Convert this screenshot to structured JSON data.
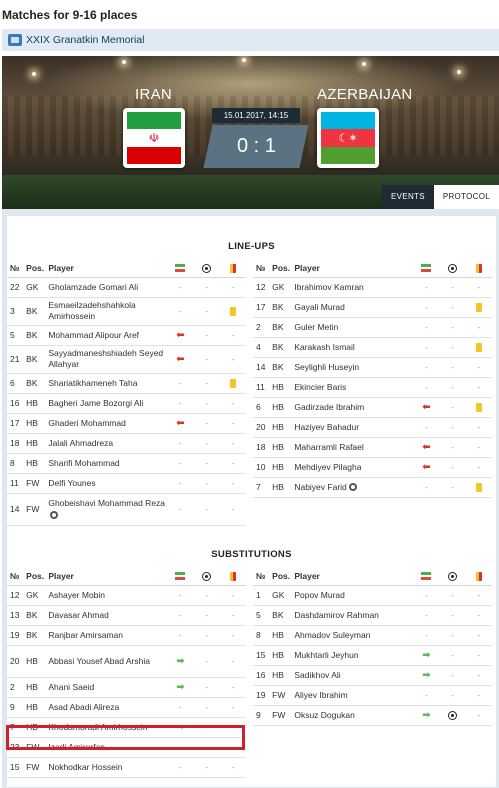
{
  "page_title": "Matches for 9-16 places",
  "tournament": {
    "name": "XXIX Granatkin Memorial",
    "icon": "trophy-icon"
  },
  "match": {
    "home_team": "IRAN",
    "away_team": "AZERBAIJAN",
    "datetime": "15.01.2017, 14:15",
    "score": "0 : 1"
  },
  "tabs": {
    "events": "EVENTS",
    "protocol": "PROTOCOL"
  },
  "colors": {
    "sub_in": "#5cb85c",
    "sub_out": "#d9342b",
    "yellow_card": "#f3c623",
    "highlight": "#d0202e"
  },
  "headers": {
    "no": "№",
    "pos": "Pos.",
    "player": "Player"
  },
  "lineups_title": "LINE-UPS",
  "subs_title": "SUBSTITUTIONS",
  "lineups_home": [
    {
      "no": "22",
      "pos": "GK",
      "name": "Gholamzade Gomari Ali",
      "sub": "-",
      "goal": "-",
      "card": "-"
    },
    {
      "no": "3",
      "pos": "BK",
      "name": "Esmaeilzadehshahkola Amirhossein",
      "sub": "-",
      "goal": "-",
      "card": "yellow"
    },
    {
      "no": "5",
      "pos": "BK",
      "name": "Mohammad Alipour Aref",
      "sub": "out",
      "goal": "-",
      "card": "-"
    },
    {
      "no": "21",
      "pos": "BK",
      "name": "Sayyadmaneshshiadeh Seyed Allahyar",
      "sub": "out",
      "goal": "-",
      "card": "-"
    },
    {
      "no": "6",
      "pos": "BK",
      "name": "Shariatikhameneh Taha",
      "sub": "-",
      "goal": "-",
      "card": "yellow"
    },
    {
      "no": "16",
      "pos": "HB",
      "name": "Bagheri Jame Bozorgi Ali",
      "sub": "-",
      "goal": "-",
      "card": "-"
    },
    {
      "no": "17",
      "pos": "HB",
      "name": "Ghaderi Mohammad",
      "sub": "out",
      "goal": "-",
      "card": "-"
    },
    {
      "no": "18",
      "pos": "HB",
      "name": "Jalali Ahmadreza",
      "sub": "-",
      "goal": "-",
      "card": "-"
    },
    {
      "no": "8",
      "pos": "HB",
      "name": "Sharifi Mohammad",
      "sub": "-",
      "goal": "-",
      "card": "-"
    },
    {
      "no": "11",
      "pos": "FW",
      "name": "Delfi Younes",
      "sub": "-",
      "goal": "-",
      "card": "-"
    },
    {
      "no": "14",
      "pos": "FW",
      "name": "Ghobeishavi Mohammad Reza",
      "captain": true,
      "sub": "-",
      "goal": "-",
      "card": "-"
    }
  ],
  "lineups_away": [
    {
      "no": "12",
      "pos": "GK",
      "name": "Ibrahimov Kamran",
      "sub": "-",
      "goal": "-",
      "card": "-"
    },
    {
      "no": "17",
      "pos": "BK",
      "name": "Gayali Murad",
      "sub": "-",
      "goal": "-",
      "card": "yellow"
    },
    {
      "no": "2",
      "pos": "BK",
      "name": "Guler Metin",
      "sub": "-",
      "goal": "-",
      "card": "-"
    },
    {
      "no": "4",
      "pos": "BK",
      "name": "Karakash Ismail",
      "sub": "-",
      "goal": "-",
      "card": "yellow"
    },
    {
      "no": "14",
      "pos": "BK",
      "name": "Seylighli Huseyin",
      "sub": "-",
      "goal": "-",
      "card": "-"
    },
    {
      "no": "11",
      "pos": "HB",
      "name": "Ekincier Baris",
      "sub": "-",
      "goal": "-",
      "card": "-"
    },
    {
      "no": "6",
      "pos": "HB",
      "name": "Gadirzade Ibrahim",
      "sub": "out",
      "goal": "-",
      "card": "yellow"
    },
    {
      "no": "20",
      "pos": "HB",
      "name": "Haziyev Bahadur",
      "sub": "-",
      "goal": "-",
      "card": "-"
    },
    {
      "no": "18",
      "pos": "HB",
      "name": "Maharramli Rafael",
      "sub": "out",
      "goal": "-",
      "card": "-"
    },
    {
      "no": "10",
      "pos": "HB",
      "name": "Mehdiyev Pilagha",
      "sub": "out",
      "goal": "-",
      "card": "-"
    },
    {
      "no": "7",
      "pos": "HB",
      "name": "Nabiyev Farid",
      "captain": true,
      "sub": "-",
      "goal": "-",
      "card": "yellow"
    }
  ],
  "subs_home": [
    {
      "no": "12",
      "pos": "GK",
      "name": "Ashayer Mobin",
      "sub": "-",
      "goal": "-",
      "card": "-"
    },
    {
      "no": "13",
      "pos": "BK",
      "name": "Davasar Ahmad",
      "sub": "-",
      "goal": "-",
      "card": "-"
    },
    {
      "no": "19",
      "pos": "BK",
      "name": "Ranjbar Amirsaman",
      "sub": "-",
      "goal": "-",
      "card": "-"
    },
    {
      "no": "20",
      "pos": "HB",
      "name": "Abbasi Yousef Abad Arshia",
      "sub": "in",
      "goal": "-",
      "card": "-"
    },
    {
      "no": "2",
      "pos": "HB",
      "name": "Ahani Saeid",
      "sub": "in",
      "goal": "-",
      "card": "-"
    },
    {
      "no": "9",
      "pos": "HB",
      "name": "Asad Abadi Alireza",
      "sub": "-",
      "goal": "-",
      "card": "-"
    },
    {
      "no": "7",
      "pos": "HB",
      "name": "Khodamoradi Amirhossein",
      "sub": "in",
      "goal": "-",
      "card": "-"
    },
    {
      "no": "23",
      "pos": "FW",
      "name": "Izadi Amirerfan",
      "sub": "-",
      "goal": "-",
      "card": "-"
    },
    {
      "no": "15",
      "pos": "FW",
      "name": "Nokhodkar Hossein",
      "sub": "-",
      "goal": "-",
      "card": "-"
    }
  ],
  "subs_away": [
    {
      "no": "1",
      "pos": "GK",
      "name": "Popov Murad",
      "sub": "-",
      "goal": "-",
      "card": "-"
    },
    {
      "no": "5",
      "pos": "BK",
      "name": "Dashdamirov Rahman",
      "sub": "-",
      "goal": "-",
      "card": "-"
    },
    {
      "no": "8",
      "pos": "HB",
      "name": "Ahmadov Suleyman",
      "sub": "-",
      "goal": "-",
      "card": "-"
    },
    {
      "no": "15",
      "pos": "HB",
      "name": "Mukhtarli Jeyhun",
      "sub": "in",
      "goal": "-",
      "card": "-"
    },
    {
      "no": "16",
      "pos": "HB",
      "name": "Sadikhov Ali",
      "sub": "in",
      "goal": "-",
      "card": "-"
    },
    {
      "no": "19",
      "pos": "FW",
      "name": "Aliyev Ibrahim",
      "sub": "-",
      "goal": "-",
      "card": "-"
    },
    {
      "no": "9",
      "pos": "FW",
      "name": "Oksuz Dogukan",
      "sub": "in",
      "goal": "goal",
      "card": "-"
    }
  ]
}
